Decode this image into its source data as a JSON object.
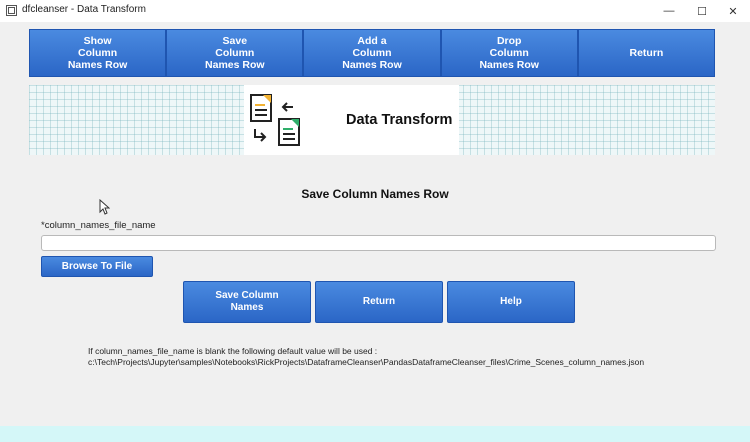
{
  "window": {
    "title": "dfcleanser - Data Transform",
    "minimize_glyph": "—",
    "maximize_glyph": "☐",
    "close_glyph": "✕"
  },
  "navbar": {
    "buttons": [
      {
        "label": "Show\nColumn\nNames Row"
      },
      {
        "label": "Save\nColumn\nNames Row"
      },
      {
        "label": "Add a\nColumn\nNames Row"
      },
      {
        "label": "Drop\nColumn\nNames Row"
      },
      {
        "label": "Return"
      }
    ]
  },
  "banner": {
    "title": "Data Transform",
    "icon": "document-transform-icon"
  },
  "form": {
    "section_title": "Save Column Names Row",
    "field_label": "*column_names_file_name",
    "field_value": "",
    "browse_label": "Browse To File",
    "actions": [
      {
        "label": "Save Column\nNames"
      },
      {
        "label": "Return"
      },
      {
        "label": "Help"
      }
    ]
  },
  "note": {
    "line1": "If column_names_file_name is blank the following default value will be used :",
    "line2": "c:\\Tech\\Projects\\Jupyter\\samples\\Notebooks\\RickProjects\\DataframeCleanser\\PandasDataframeCleanser_files\\Crime_Scenes_column_names.json"
  },
  "colors": {
    "button_blue": "#2f6fd0",
    "banner_grid": "#78b4be",
    "bottom_bar": "#d4f7f8"
  }
}
